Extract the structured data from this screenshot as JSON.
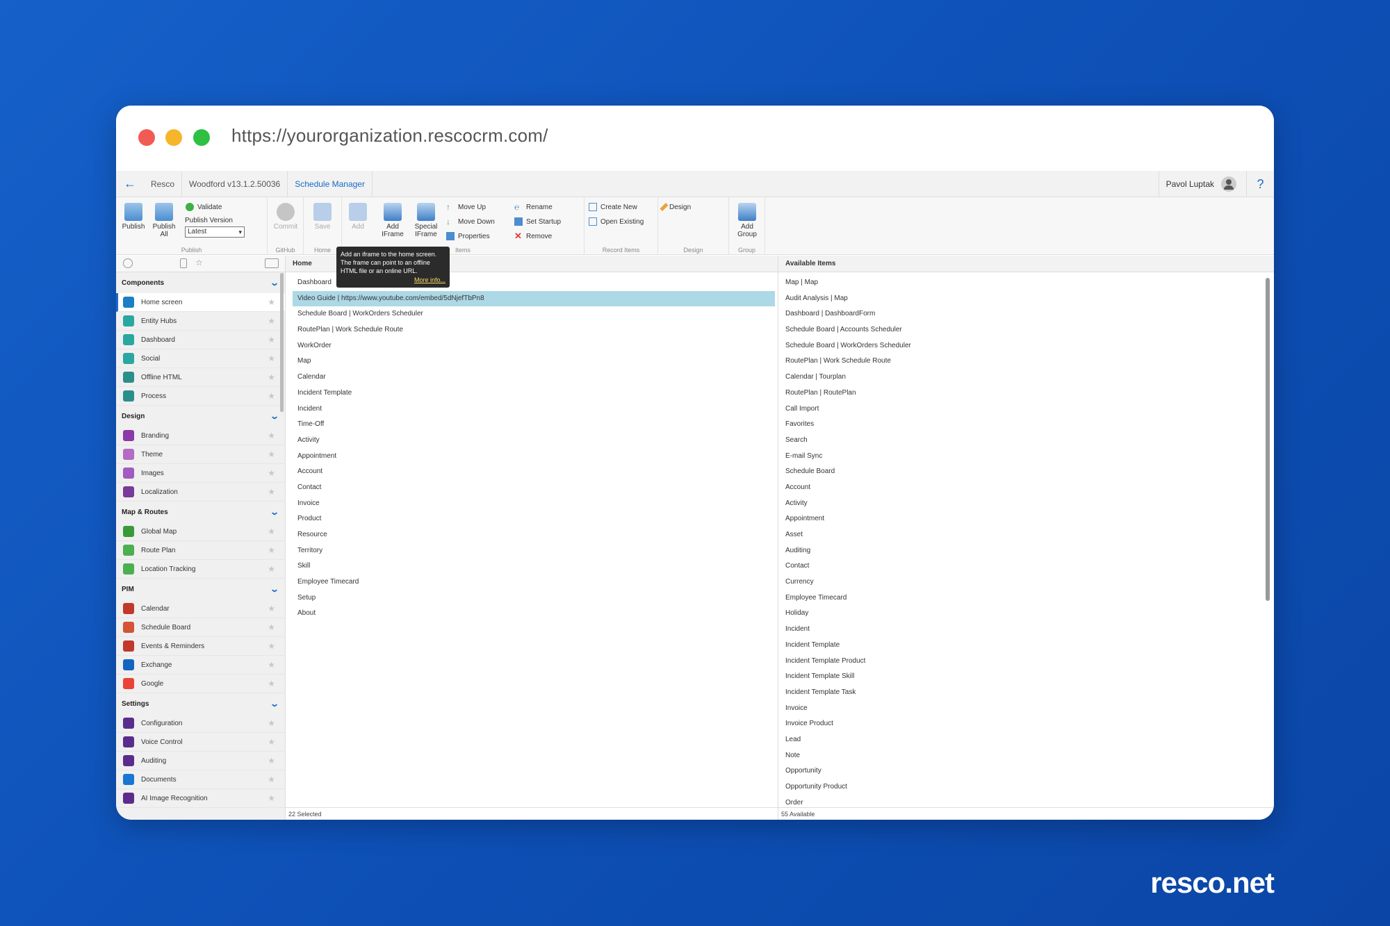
{
  "browser": {
    "url": "https://yourorganization.rescocrm.com/"
  },
  "navbar": {
    "crumbs": [
      "Resco",
      "Woodford v13.1.2.50036",
      "Schedule Manager"
    ],
    "user": "Pavol Luptak",
    "help": "?"
  },
  "ribbon": {
    "publish": {
      "publish": "Publish",
      "publish_all": "Publish All",
      "validate": "Validate",
      "publish_version": "Publish Version",
      "version_value": "Latest",
      "group": "Publish"
    },
    "github": {
      "commit": "Commit",
      "group": "GitHub"
    },
    "home": {
      "save": "Save",
      "group": "Home"
    },
    "items": {
      "add": "Add",
      "add_iframe": "Add IFrame",
      "special_iframe": "Special IFrame",
      "move_up": "Move Up",
      "move_down": "Move Down",
      "properties": "Properties",
      "rename": "Rename",
      "set_startup": "Set Startup",
      "remove": "Remove",
      "group": "Items"
    },
    "record_items": {
      "create_new": "Create New",
      "open_existing": "Open Existing",
      "group": "Record Items"
    },
    "design": {
      "design": "Design",
      "group": "Design"
    },
    "group_section": {
      "add_group": "Add Group",
      "group": "Group"
    }
  },
  "tooltip": {
    "text": "Add an iframe to the home screen. The frame can point to an offline HTML file or an online URL.",
    "link": "More info..."
  },
  "sidebar": {
    "sections": [
      {
        "title": "Components",
        "items": [
          {
            "label": "Home screen",
            "color": "#1a7fc4"
          },
          {
            "label": "Entity Hubs",
            "color": "#2aa7a0"
          },
          {
            "label": "Dashboard",
            "color": "#2aa7a0"
          },
          {
            "label": "Social",
            "color": "#2aa7a0"
          },
          {
            "label": "Offline HTML",
            "color": "#2a8f8a"
          },
          {
            "label": "Process",
            "color": "#2a8f8a"
          }
        ]
      },
      {
        "title": "Design",
        "items": [
          {
            "label": "Branding",
            "color": "#8b3aa8"
          },
          {
            "label": "Theme",
            "color": "#b36bc4"
          },
          {
            "label": "Images",
            "color": "#a05cc0"
          },
          {
            "label": "Localization",
            "color": "#7a3a9a"
          }
        ]
      },
      {
        "title": "Map & Routes",
        "items": [
          {
            "label": "Global Map",
            "color": "#3a9a3a"
          },
          {
            "label": "Route Plan",
            "color": "#4caf50"
          },
          {
            "label": "Location Tracking",
            "color": "#4caf50"
          }
        ]
      },
      {
        "title": "PIM",
        "items": [
          {
            "label": "Calendar",
            "color": "#c0392b"
          },
          {
            "label": "Schedule Board",
            "color": "#d35437"
          },
          {
            "label": "Events & Reminders",
            "color": "#c0392b"
          },
          {
            "label": "Exchange",
            "color": "#1565c0"
          },
          {
            "label": "Google",
            "color": "#ea4335"
          }
        ]
      },
      {
        "title": "Settings",
        "items": [
          {
            "label": "Configuration",
            "color": "#5a2d8c"
          },
          {
            "label": "Voice Control",
            "color": "#5a2d8c"
          },
          {
            "label": "Auditing",
            "color": "#5a2d8c"
          },
          {
            "label": "Documents",
            "color": "#1976d2"
          },
          {
            "label": "AI Image Recognition",
            "color": "#5a2d8c"
          }
        ]
      }
    ]
  },
  "home": {
    "header": "Home",
    "items": [
      "Dashboard",
      "Video Guide | https://www.youtube.com/embed/5dNjefTbPn8",
      "Schedule Board | WorkOrders Scheduler",
      "RoutePlan | Work Schedule Route",
      "WorkOrder",
      "Map",
      "Calendar",
      "Incident Template",
      "Incident",
      "Time-Off",
      "Activity",
      "Appointment",
      "Account",
      "Contact",
      "Invoice",
      "Product",
      "Resource",
      "Territory",
      "Skill",
      "Employee Timecard",
      "Setup",
      "About"
    ],
    "footer": "22 Selected"
  },
  "available": {
    "header": "Available Items",
    "items": [
      "Map | Map",
      "Audit Analysis | Map",
      "Dashboard | DashboardForm",
      "Schedule Board | Accounts Scheduler",
      "Schedule Board | WorkOrders Scheduler",
      "RoutePlan | Work Schedule Route",
      "Calendar | Tourplan",
      "RoutePlan | RoutePlan",
      "Call Import",
      "Favorites",
      "Search",
      "E-mail Sync",
      "Schedule Board",
      "Account",
      "Activity",
      "Appointment",
      "Asset",
      "Auditing",
      "Contact",
      "Currency",
      "Employee Timecard",
      "Holiday",
      "Incident",
      "Incident Template",
      "Incident Template Product",
      "Incident Template Skill",
      "Incident Template Task",
      "Invoice",
      "Invoice Product",
      "Lead",
      "Note",
      "Opportunity",
      "Opportunity Product",
      "Order"
    ],
    "footer": "55 Available"
  },
  "brand": "resco.net"
}
